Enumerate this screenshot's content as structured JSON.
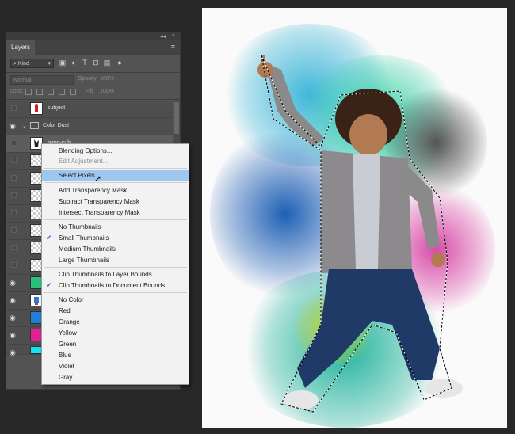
{
  "panel": {
    "tab": "Layers",
    "collapse": "◂◂",
    "close": "×",
    "menu_glyph": "≡",
    "filter_kind": "Kind",
    "blend_mode": "Normal",
    "opacity_label": "Opacity:",
    "opacity_value": "100%",
    "lock_label": "Lock:",
    "fill_label": "Fill:",
    "fill_value": "100%"
  },
  "layers": [
    {
      "name": "subject",
      "visible": false,
      "thumb": "subject"
    },
    {
      "name": "Color Dust",
      "visible": true,
      "thumb": "folder"
    },
    {
      "name": "temp-sub",
      "visible": false,
      "thumb": "figure"
    },
    {
      "name": "",
      "visible": false,
      "thumb": "checker"
    },
    {
      "name": "",
      "visible": false,
      "thumb": "checker"
    },
    {
      "name": "",
      "visible": false,
      "thumb": "checker"
    },
    {
      "name": "",
      "visible": false,
      "thumb": "checker"
    },
    {
      "name": "",
      "visible": false,
      "thumb": "checker"
    },
    {
      "name": "",
      "visible": false,
      "thumb": "checker"
    },
    {
      "name": "",
      "visible": false,
      "thumb": "checker"
    },
    {
      "name": "",
      "visible": true,
      "thumb": "green"
    },
    {
      "name": "",
      "visible": true,
      "thumb": "figure-color"
    },
    {
      "name": "",
      "visible": true,
      "thumb": "blue"
    },
    {
      "name": "",
      "visible": true,
      "thumb": "magenta"
    },
    {
      "name": "",
      "visible": true,
      "thumb": "cyan"
    }
  ],
  "context_menu": {
    "items": [
      {
        "label": "Blending Options...",
        "disabled": false,
        "checked": false,
        "highlighted": false
      },
      {
        "label": "Edit Adjustment...",
        "disabled": true,
        "checked": false,
        "highlighted": false
      },
      {
        "label": "Select Pixels",
        "disabled": false,
        "checked": false,
        "highlighted": true
      },
      {
        "label": "Add Transparency Mask",
        "disabled": false,
        "checked": false,
        "highlighted": false
      },
      {
        "label": "Subtract Transparency Mask",
        "disabled": false,
        "checked": false,
        "highlighted": false
      },
      {
        "label": "Intersect Transparency Mask",
        "disabled": false,
        "checked": false,
        "highlighted": false
      },
      {
        "label": "No Thumbnails",
        "disabled": false,
        "checked": false,
        "highlighted": false
      },
      {
        "label": "Small Thumbnails",
        "disabled": false,
        "checked": true,
        "highlighted": false
      },
      {
        "label": "Medium Thumbnails",
        "disabled": false,
        "checked": false,
        "highlighted": false
      },
      {
        "label": "Large Thumbnails",
        "disabled": false,
        "checked": false,
        "highlighted": false
      },
      {
        "label": "Clip Thumbnails to Layer Bounds",
        "disabled": false,
        "checked": false,
        "highlighted": false
      },
      {
        "label": "Clip Thumbnails to Document Bounds",
        "disabled": false,
        "checked": true,
        "highlighted": false
      },
      {
        "label": "No Color",
        "disabled": false,
        "checked": false,
        "highlighted": false
      },
      {
        "label": "Red",
        "disabled": false,
        "checked": false,
        "highlighted": false
      },
      {
        "label": "Orange",
        "disabled": false,
        "checked": false,
        "highlighted": false
      },
      {
        "label": "Yellow",
        "disabled": false,
        "checked": false,
        "highlighted": false
      },
      {
        "label": "Green",
        "disabled": false,
        "checked": false,
        "highlighted": false
      },
      {
        "label": "Blue",
        "disabled": false,
        "checked": false,
        "highlighted": false
      },
      {
        "label": "Violet",
        "disabled": false,
        "checked": false,
        "highlighted": false
      },
      {
        "label": "Gray",
        "disabled": false,
        "checked": false,
        "highlighted": false
      }
    ]
  },
  "icons": {
    "eye": "eye-icon",
    "checkmark": "checkmark-icon",
    "cursor": "pointer-cursor-icon"
  },
  "colors": {
    "highlight": "#9ec7ef",
    "check": "#2a6fc5",
    "panel": "#535353"
  }
}
